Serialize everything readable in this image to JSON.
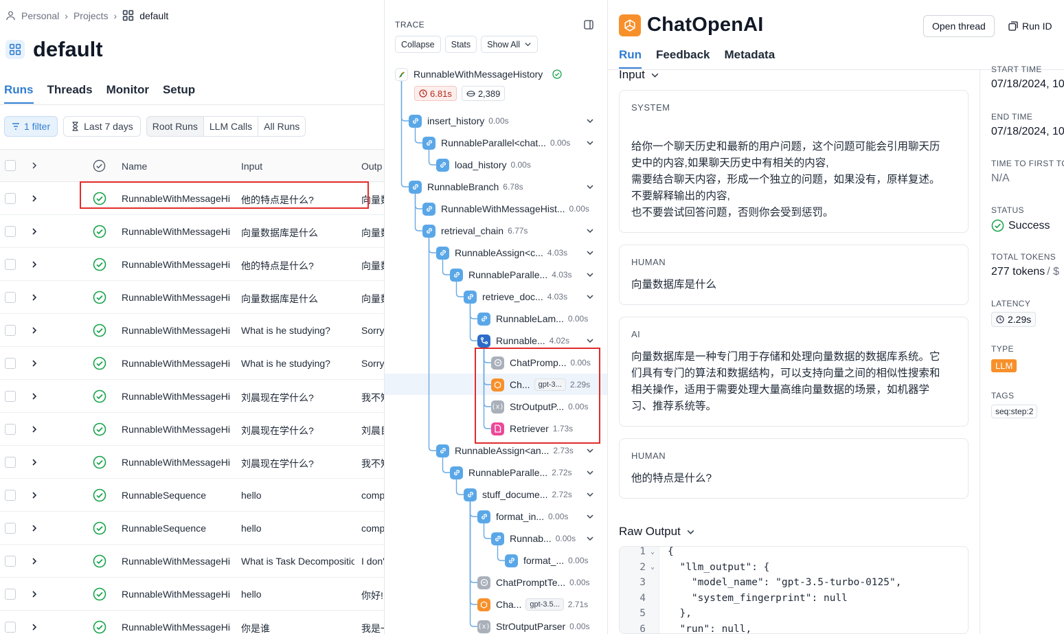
{
  "breadcrumb": {
    "personal": "Personal",
    "projects": "Projects",
    "current": "default"
  },
  "page_title": "default",
  "left_tabs": [
    "Runs",
    "Threads",
    "Monitor",
    "Setup"
  ],
  "filters": {
    "filter_chip": "1 filter",
    "date_chip": "Last 7 days",
    "segments": [
      "Root Runs",
      "LLM Calls",
      "All Runs"
    ]
  },
  "table": {
    "headers": {
      "name": "Name",
      "input": "Input",
      "output": "Outp"
    },
    "rows": [
      {
        "name": "RunnableWithMessageHistory",
        "input": "他的特点是什么?",
        "output": "向量数据库"
      },
      {
        "name": "RunnableWithMessageHistory",
        "input": "向量数据库是什么",
        "output": "向量数据库"
      },
      {
        "name": "RunnableWithMessageHistory",
        "input": "他的特点是什么?",
        "output": "向量数据库"
      },
      {
        "name": "RunnableWithMessageHistory",
        "input": "向量数据库是什么",
        "output": "向量数据库"
      },
      {
        "name": "RunnableWithMessageHistory",
        "input": "What is he studying?",
        "output": "Sorry"
      },
      {
        "name": "RunnableWithMessageHistory",
        "input": "What is he studying?",
        "output": "Sorry"
      },
      {
        "name": "RunnableWithMessageHistory",
        "input": "刘晨现在学什么?",
        "output": "我不知道"
      },
      {
        "name": "RunnableWithMessageHistory",
        "input": "刘晨现在学什么?",
        "output": "刘晨目前"
      },
      {
        "name": "RunnableWithMessageHistory",
        "input": "刘晨现在学什么?",
        "output": "我不知道"
      },
      {
        "name": "RunnableSequence",
        "input": "hello",
        "output": "comp"
      },
      {
        "name": "RunnableSequence",
        "input": "hello",
        "output": "comp"
      },
      {
        "name": "RunnableWithMessageHistory",
        "input": "What is Task Decomposition?",
        "output": "I don't"
      },
      {
        "name": "RunnableWithMessageHistory",
        "input": "hello",
        "output": "你好!"
      },
      {
        "name": "RunnableWithMessageHistory",
        "input": "你是谁",
        "output": "我是一"
      }
    ]
  },
  "trace": {
    "label": "TRACE",
    "buttons": {
      "collapse": "Collapse",
      "stats": "Stats",
      "show_all": "Show All"
    },
    "root": {
      "name": "RunnableWithMessageHistory",
      "latency": "6.81s",
      "tokens": "2,389"
    },
    "nodes": [
      {
        "name": "insert_history",
        "time": "0.00s",
        "depth": 1,
        "kind": "chain",
        "chev": true
      },
      {
        "name": "RunnableParallel<chat...",
        "time": "0.00s",
        "depth": 2,
        "kind": "chain",
        "chev": true
      },
      {
        "name": "load_history",
        "time": "0.00s",
        "depth": 3,
        "kind": "chain",
        "chev": false
      },
      {
        "name": "RunnableBranch",
        "time": "6.78s",
        "depth": 1,
        "kind": "chain",
        "chev": true
      },
      {
        "name": "RunnableWithMessageHist...",
        "time": "0.00s",
        "depth": 2,
        "kind": "chain",
        "chev": false
      },
      {
        "name": "retrieval_chain",
        "time": "6.77s",
        "depth": 2,
        "kind": "chain",
        "chev": true
      },
      {
        "name": "RunnableAssign<c...",
        "time": "4.03s",
        "depth": 3,
        "kind": "chain",
        "chev": true
      },
      {
        "name": "RunnableParalle...",
        "time": "4.03s",
        "depth": 4,
        "kind": "chain",
        "chev": true
      },
      {
        "name": "retrieve_doc...",
        "time": "4.03s",
        "depth": 5,
        "kind": "chain",
        "chev": true
      },
      {
        "name": "RunnableLam...",
        "time": "0.00s",
        "depth": 6,
        "kind": "chain",
        "chev": false
      },
      {
        "name": "Runnable...",
        "time": "4.02s",
        "depth": 6,
        "kind": "branch",
        "chev": true
      },
      {
        "name": "ChatPromp...",
        "time": "0.00s",
        "depth": 7,
        "kind": "prompt",
        "chev": false
      },
      {
        "name": "Ch...",
        "time": "2.29s",
        "depth": 7,
        "kind": "llm",
        "chev": false,
        "model": "gpt-3..."
      },
      {
        "name": "StrOutputP...",
        "time": "0.00s",
        "depth": 7,
        "kind": "parser",
        "chev": false
      },
      {
        "name": "Retriever",
        "time": "1.73s",
        "depth": 7,
        "kind": "retriever",
        "chev": false
      },
      {
        "name": "RunnableAssign<an...",
        "time": "2.73s",
        "depth": 3,
        "kind": "chain",
        "chev": true
      },
      {
        "name": "RunnableParalle...",
        "time": "2.72s",
        "depth": 4,
        "kind": "chain",
        "chev": true
      },
      {
        "name": "stuff_docume...",
        "time": "2.72s",
        "depth": 5,
        "kind": "chain",
        "chev": true
      },
      {
        "name": "format_in...",
        "time": "0.00s",
        "depth": 6,
        "kind": "chain",
        "chev": true
      },
      {
        "name": "Runnab...",
        "time": "0.00s",
        "depth": 7,
        "kind": "chain",
        "chev": true
      },
      {
        "name": "format_...",
        "time": "0.00s",
        "depth": 8,
        "kind": "chain",
        "chev": false
      },
      {
        "name": "ChatPromptTe...",
        "time": "0.00s",
        "depth": 6,
        "kind": "prompt",
        "chev": false
      },
      {
        "name": "Cha...",
        "time": "2.71s",
        "depth": 6,
        "kind": "llm",
        "chev": false,
        "model": "gpt-3.5..."
      },
      {
        "name": "StrOutputParser",
        "time": "0.00s",
        "depth": 6,
        "kind": "parser",
        "chev": false
      }
    ]
  },
  "detail": {
    "title": "ChatOpenAI",
    "open_thread": "Open thread",
    "run_id": "Run ID",
    "tabs": [
      "Run",
      "Feedback",
      "Metadata"
    ],
    "input_title": "Input",
    "messages": [
      {
        "role": "SYSTEM",
        "text": [
          "给你一个聊天历史和最新的用户问题，这个问题可能会引用聊天历",
          "史中的内容,如果聊天历史中有相关的内容,",
          "需要结合聊天内容，形成一个独立的问题，如果没有，原样复述。",
          "不要解释输出的内容,",
          "也不要尝试回答问题，否则你会受到惩罚。"
        ]
      },
      {
        "role": "HUMAN",
        "text": [
          "向量数据库是什么"
        ]
      },
      {
        "role": "AI",
        "text": [
          "向量数据库是一种专门用于存储和处理向量数据的数据库系统。它",
          "们具有专门的算法和数据结构，可以支持向量之间的相似性搜索和",
          "相关操作，适用于需要处理大量高维向量数据的场景，如机器学",
          "习、推荐系统等。"
        ]
      },
      {
        "role": "HUMAN",
        "text": [
          "他的特点是什么?"
        ]
      }
    ],
    "raw_output_title": "Raw Output",
    "code_lines": [
      {
        "n": "1",
        "fold": true,
        "text": "{"
      },
      {
        "n": "2",
        "fold": true,
        "text": "  \"llm_output\": {"
      },
      {
        "n": "3",
        "fold": false,
        "text": "    \"model_name\": \"gpt-3.5-turbo-0125\","
      },
      {
        "n": "4",
        "fold": false,
        "text": "    \"system_fingerprint\": null"
      },
      {
        "n": "5",
        "fold": false,
        "text": "  },"
      },
      {
        "n": "6",
        "fold": false,
        "text": "  \"run\": null,"
      }
    ],
    "meta": {
      "start_time_label": "START TIME",
      "start_time": "07/18/2024, 10",
      "end_time_label": "END TIME",
      "end_time": "07/18/2024, 10",
      "ttft_label": "TIME TO FIRST TO",
      "ttft": "N/A",
      "status_label": "STATUS",
      "status": "Success",
      "tokens_label": "TOTAL TOKENS",
      "tokens": "277 tokens",
      "tokens_sep": "/ $",
      "latency_label": "LATENCY",
      "latency": "2.29s",
      "type_label": "TYPE",
      "type": "LLM",
      "tags_label": "TAGS",
      "tag": "seq:step:2"
    }
  },
  "colors": {
    "accent": "#2f7dd1",
    "success": "#16a34a",
    "highlight": "#e22a2a",
    "openai": "#f7902b",
    "retriever": "#ec4899",
    "chain": "#5aa7e8"
  }
}
